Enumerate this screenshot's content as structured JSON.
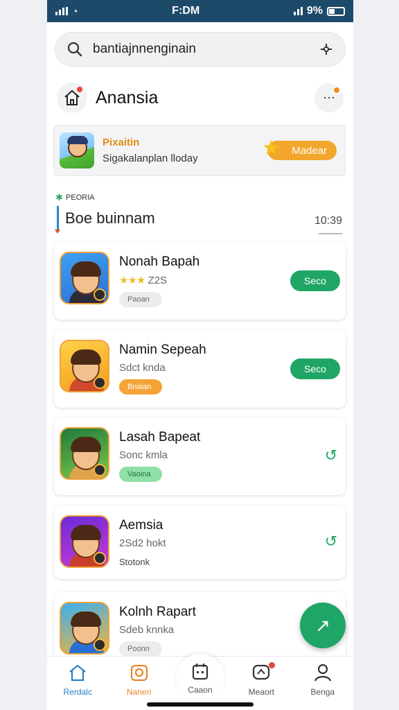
{
  "status_bar": {
    "center_text": "F:DM",
    "battery": "9%"
  },
  "search": {
    "value": "bantiajnnenginain"
  },
  "header": {
    "title": "Anansia"
  },
  "promo": {
    "title": "Pixaitin",
    "subtitle": "Sigakalanplan lloday",
    "button_label": "Madear"
  },
  "section": {
    "tag": "PEORIA",
    "title": "Boe buinnam",
    "time": "10:39"
  },
  "apps": [
    {
      "name": "Nonah Bapah",
      "rating_stars": "★★★",
      "sub": "Z2S",
      "chip": "Paoan",
      "chip_style": "grey",
      "action": "Seco",
      "action_type": "button",
      "icon_bg": "linear-gradient(160deg,#3fa0f0,#2a6fd6)",
      "shirt": "#2b2b3a"
    },
    {
      "name": "Namin Sepeah",
      "sub": "Sdct knda",
      "chip": "Bnaian",
      "chip_style": "orange",
      "action": "Seco",
      "action_type": "button",
      "icon_bg": "linear-gradient(160deg,#ffd24a,#f29a1c)",
      "shirt": "#d24a2c"
    },
    {
      "name": "Lasah Bapeat",
      "sub": "Sonc kmla",
      "chip": "Vaoina",
      "chip_style": "green",
      "action_type": "icon",
      "icon_bg": "linear-gradient(160deg,#1f7a3a,#7ec94a)",
      "shirt": "#e0a24a"
    },
    {
      "name": "Aemsia",
      "sub": "2Sd2 hokt",
      "chip": "Stotonk",
      "chip_style": "plain",
      "action_type": "icon",
      "icon_bg": "linear-gradient(160deg,#6a2bd6,#c93ad6)",
      "shirt": "#c8402c"
    },
    {
      "name": "Kolnh Rapart",
      "sub": "Sdeb knnka",
      "chip": "Poonn",
      "chip_style": "grey",
      "action_type": "none",
      "icon_bg": "linear-gradient(160deg,#3ab0f0,#f2b43a)",
      "shirt": "#2a6fd6"
    }
  ],
  "nav": [
    {
      "label": "Rerdalc",
      "icon": "home-icon",
      "state": "active"
    },
    {
      "label": "Naneri",
      "icon": "camera-icon",
      "state": "orange"
    },
    {
      "label": "Caaon",
      "icon": "calendar-icon",
      "state": "center"
    },
    {
      "label": "Meaort",
      "icon": "chat-icon",
      "state": "dot"
    },
    {
      "label": "Benga",
      "icon": "profile-icon",
      "state": "normal"
    }
  ],
  "colors": {
    "accent": "#1fa666",
    "status_bar": "#1e4a6a",
    "promo": "#f3a62c"
  }
}
